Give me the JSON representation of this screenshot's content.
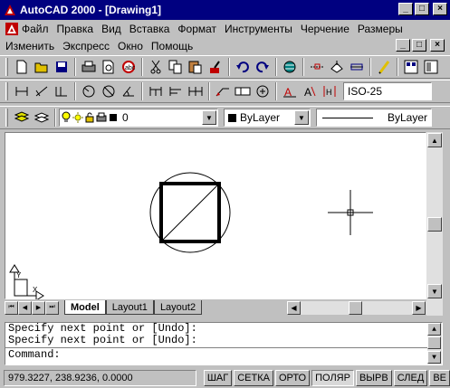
{
  "window": {
    "title": "AutoCAD 2000 - [Drawing1]",
    "minimize_glyph": "_",
    "maximize_glyph": "□",
    "close_glyph": "×"
  },
  "menu": {
    "row1": [
      "Файл",
      "Правка",
      "Вид",
      "Вставка",
      "Формат",
      "Инструменты",
      "Черчение",
      "Размеры"
    ],
    "row2": [
      "Изменить",
      "Экспресс",
      "Окно",
      "Помощь"
    ]
  },
  "toolbar_dim": {
    "dimstyle_value": "ISO-25"
  },
  "layers": {
    "current_layer": "0",
    "color_value": "ByLayer",
    "linetype_value": "ByLayer"
  },
  "tabs": {
    "items": [
      "Model",
      "Layout1",
      "Layout2"
    ],
    "active": "Model"
  },
  "command": {
    "lines": [
      "Specify next point or [Undo]:",
      "Specify next point or [Undo]:"
    ],
    "prompt": "Command:"
  },
  "status": {
    "coordinates": "979.3227, 238.9236, 0.0000",
    "toggles": [
      {
        "label": "ШАГ",
        "on": false
      },
      {
        "label": "СЕТКА",
        "on": false
      },
      {
        "label": "ОРТО",
        "on": false
      },
      {
        "label": "ПОЛЯР",
        "on": true
      },
      {
        "label": "ВЫРВ",
        "on": false
      },
      {
        "label": "СЛЕД",
        "on": false
      },
      {
        "label": "ВЕ",
        "on": false
      }
    ]
  },
  "colors": {
    "titlebar": "#000080",
    "face": "#c0c0c0",
    "canvas": "#ffffff"
  }
}
